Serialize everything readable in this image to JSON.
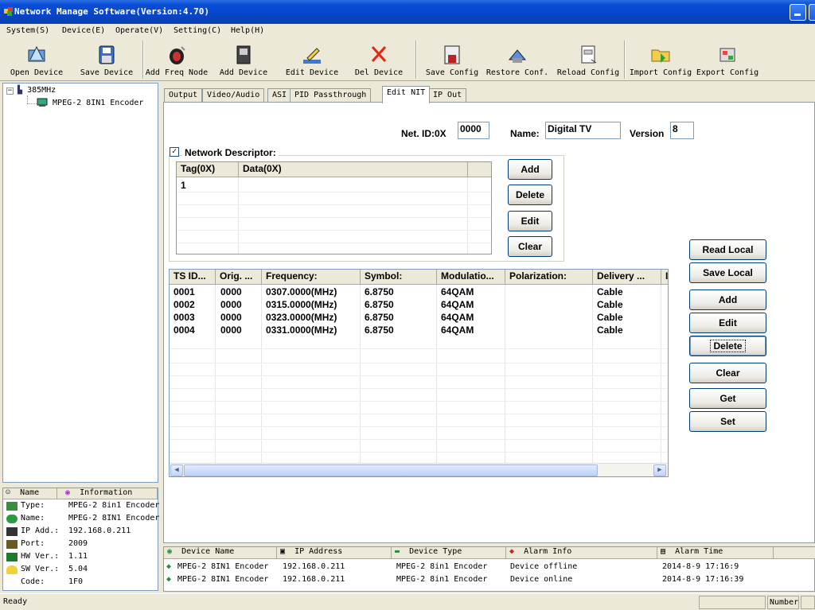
{
  "window": {
    "title": "Network Manage Software(Version:4.70)"
  },
  "menu": [
    "System(S)",
    "Device(E)",
    "Operate(V)",
    "Setting(C)",
    "Help(H)"
  ],
  "toolbar": [
    {
      "label": "Open Device",
      "icon": "open-device-icon"
    },
    {
      "label": "Save Device",
      "icon": "save-device-icon"
    },
    {
      "label": "Add Freq Node",
      "icon": "add-freq-node-icon"
    },
    {
      "label": "Add Device",
      "icon": "add-device-icon"
    },
    {
      "label": "Edit Device",
      "icon": "edit-device-icon"
    },
    {
      "label": "Del Device",
      "icon": "delete-icon"
    },
    {
      "label": "Save Config",
      "icon": "save-config-icon"
    },
    {
      "label": "Restore Conf.",
      "icon": "restore-config-icon"
    },
    {
      "label": "Reload Config",
      "icon": "reload-config-icon"
    },
    {
      "label": "Import Config",
      "icon": "import-config-icon"
    },
    {
      "label": "Export Config",
      "icon": "export-config-icon"
    }
  ],
  "tree": {
    "root": "385MHz",
    "child": "MPEG-2 8IN1 Encoder"
  },
  "info": {
    "headers": [
      "Name",
      "Information"
    ],
    "rows": [
      {
        "key": "Type:",
        "value": "MPEG-2 8in1 Encoder"
      },
      {
        "key": "Name:",
        "value": "MPEG-2 8IN1 Encoder"
      },
      {
        "key": "IP Add.:",
        "value": "192.168.0.211"
      },
      {
        "key": "Port:",
        "value": "2009"
      },
      {
        "key": "HW Ver.:",
        "value": "1.11"
      },
      {
        "key": "SW Ver.:",
        "value": "5.04"
      },
      {
        "key": "Code:",
        "value": "1F0"
      }
    ]
  },
  "tabs": [
    "Output",
    "Video/Audio",
    "ASI",
    "PID Passthrough",
    "Edit NIT",
    "IP Out"
  ],
  "active_tab": "Edit NIT",
  "nit": {
    "net_id_label": "Net. ID:0X",
    "net_id": "0000",
    "name_label": "Name:",
    "name": "Digital TV",
    "version_label": "Version",
    "version": "8",
    "network_descriptor_label": "Network Descriptor:",
    "network_descriptor_checked": "✓",
    "descriptor_headers": [
      "Tag(0X)",
      "Data(0X)"
    ],
    "descriptor_rows": [
      {
        "tag": "1",
        "data": ""
      }
    ],
    "descriptor_buttons": [
      "Add",
      "Delete",
      "Edit",
      "Clear"
    ],
    "ts_headers": [
      "TS ID...",
      "Orig. ...",
      "Frequency:",
      "Symbol:",
      "Modulatio...",
      "Polarization:",
      "Delivery ...",
      "I"
    ],
    "ts_rows": [
      {
        "ts_id": "0001",
        "orig": "0000",
        "freq": "0307.0000(MHz)",
        "symbol": "6.8750",
        "modulation": "64QAM",
        "polarization": "",
        "delivery": "Cable"
      },
      {
        "ts_id": "0002",
        "orig": "0000",
        "freq": "0315.0000(MHz)",
        "symbol": "6.8750",
        "modulation": "64QAM",
        "polarization": "",
        "delivery": "Cable"
      },
      {
        "ts_id": "0003",
        "orig": "0000",
        "freq": "0323.0000(MHz)",
        "symbol": "6.8750",
        "modulation": "64QAM",
        "polarization": "",
        "delivery": "Cable"
      },
      {
        "ts_id": "0004",
        "orig": "0000",
        "freq": "0331.0000(MHz)",
        "symbol": "6.8750",
        "modulation": "64QAM",
        "polarization": "",
        "delivery": "Cable"
      }
    ],
    "right_buttons": [
      "Read Local",
      "Save Local",
      "Add",
      "Edit",
      "Delete",
      "Clear",
      "Get",
      "Set"
    ]
  },
  "alarm": {
    "headers": [
      "Device Name",
      "IP Address",
      "Device Type",
      "Alarm Info",
      "Alarm Time"
    ],
    "rows": [
      {
        "name": "MPEG-2 8IN1 Encoder",
        "ip": "192.168.0.211",
        "type": "MPEG-2 8in1 Encoder",
        "info": "Device offline",
        "time": "2014-8-9 17:16:9"
      },
      {
        "name": "MPEG-2 8IN1 Encoder",
        "ip": "192.168.0.211",
        "type": "MPEG-2 8in1 Encoder",
        "info": "Device online",
        "time": "2014-8-9 17:16:39"
      }
    ]
  },
  "status": {
    "left": "Ready",
    "right": "Number"
  }
}
